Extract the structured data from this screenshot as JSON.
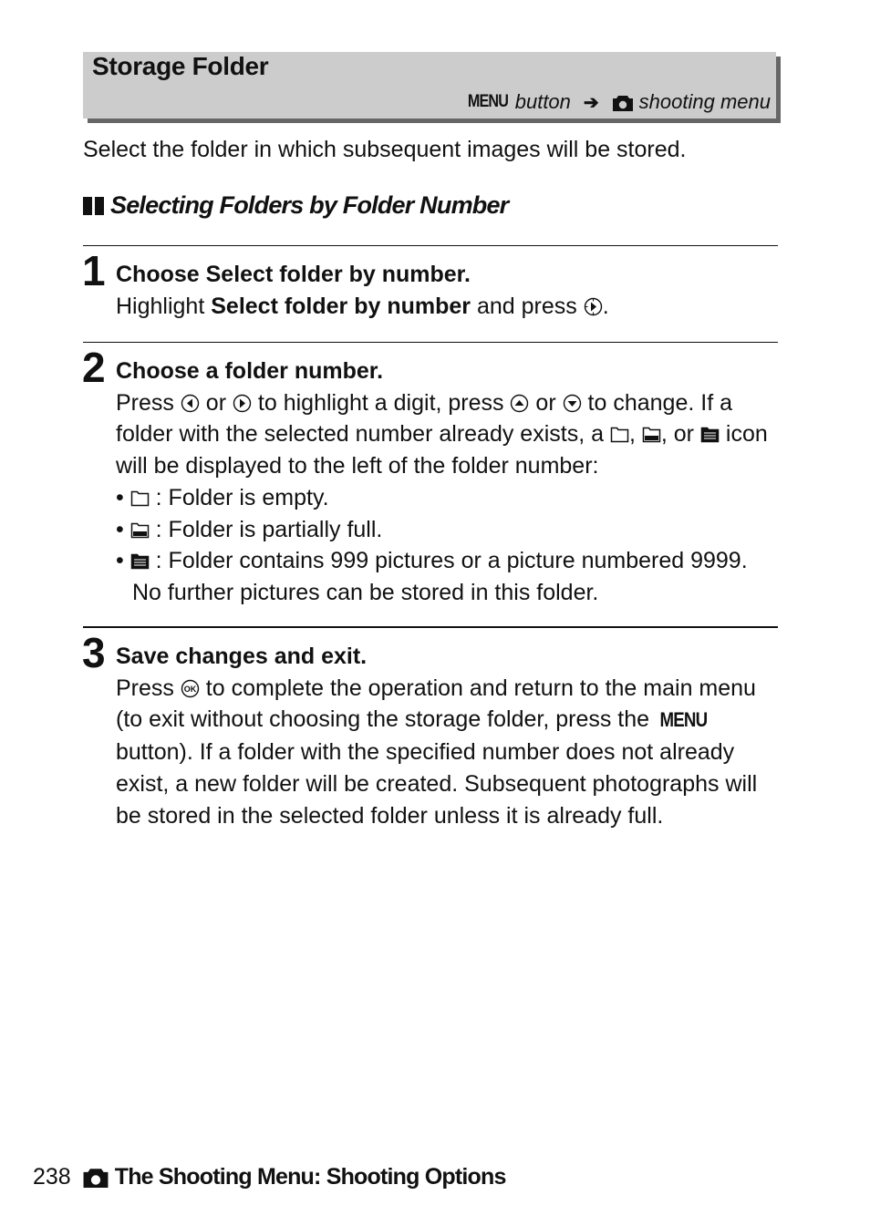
{
  "header": {
    "title": "Storage Folder",
    "menu_word": "MENU",
    "path_button": "button",
    "path_arrow": "➔",
    "path_menu": "shooting menu",
    "path_icon": "camera-icon"
  },
  "intro": "Select the folder in which subsequent images will be stored.",
  "subheading": "Selecting Folders by Folder Number",
  "steps": [
    {
      "number": "1",
      "title_prefix": "Choose ",
      "title_bold": "Select folder by number.",
      "body_a": "Highlight ",
      "body_bold": "Select folder by number",
      "body_b": " and press ",
      "body_icon": "multi-selector-right-icon",
      "body_c": "."
    },
    {
      "number": "2",
      "title": "Choose a folder number.",
      "t1": "Press ",
      "t1_icon": "multi-selector-left-icon",
      "t2": " or ",
      "t2_icon": "multi-selector-right-icon",
      "t3": " to highlight a digit, press ",
      "t3_icon": "multi-selector-up-icon",
      "t4": " or ",
      "t4_icon": "multi-selector-down-icon",
      "t5": " to change.  If a folder with the selected number already exists, a ",
      "t6": ", ",
      "t7": ", or ",
      "t8": " icon will be displayed to the left of the folder number:",
      "bullets": [
        {
          "icon": "folder-empty-icon",
          "text": " : Folder is empty."
        },
        {
          "icon": "folder-partial-icon",
          "text": " : Folder is partially full."
        },
        {
          "icon": "folder-full-icon",
          "text": " : Folder contains 999 pictures or a picture numbered 9999.  No further pictures can be stored in this folder."
        }
      ],
      "bullet_char": "•"
    },
    {
      "number": "3",
      "title": "Save changes and exit.",
      "t1": "Press ",
      "t1_icon": "ok-button-icon",
      "t2": " to complete the operation and return to the main menu (to exit without choosing the storage folder, press the ",
      "menu_word": "MENU",
      "t3": " button).  If a folder with the specified number does not already exist, a new folder will be created. Subsequent photographs will be stored in the selected folder unless it is already full."
    }
  ],
  "footer": {
    "page_number": "238",
    "section_icon": "camera-icon",
    "section_title": "The Shooting Menu: Shooting Options"
  }
}
